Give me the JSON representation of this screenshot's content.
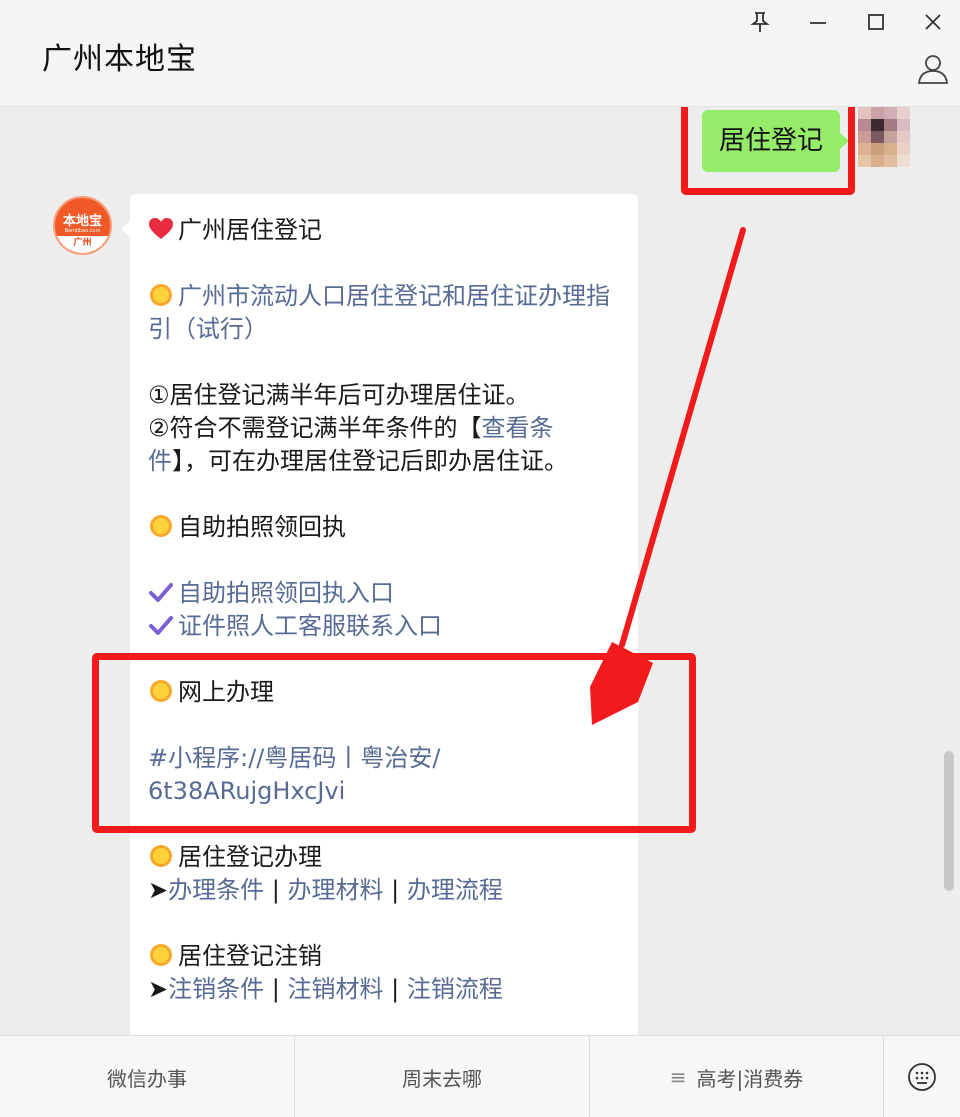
{
  "window": {
    "title": "广州本地宝",
    "controls": [
      "pin-icon",
      "minimize-icon",
      "maximize-icon",
      "close-icon",
      "profile-icon"
    ]
  },
  "sent_message": {
    "text": "居住登记"
  },
  "bot": {
    "avatar": {
      "logo_text": "本地宝",
      "domain_text": "Bendibao.com",
      "city": "广州"
    }
  },
  "reply": {
    "heading": "广州居住登记",
    "guide_link_line1": "广州市流动人口居住登记和居住证办理指",
    "guide_link_line2": "引（试行）",
    "note1": "①居住登记满半年后可办理居住证。",
    "note2_prefix": "②符合不需登记满半年条件的【",
    "note2_link_a": "查看条",
    "note2_link_b": "件",
    "note2_suffix": "】，可在办理居住登记后即办居住证。",
    "self_photo_title": "自助拍照领回执",
    "self_photo_link": "自助拍照领回执入口",
    "service_link": "证件照人工客服联系入口",
    "online_title": "网上办理",
    "miniprogram_line1": "#小程序://粤居码丨粤治安/",
    "miniprogram_line2": "6t38ARujgHxcJvi",
    "register_title": "居住登记办理",
    "register_links": [
      "办理条件",
      "办理材料",
      "办理流程"
    ],
    "cancel_title": "居住登记注销",
    "cancel_links": [
      "注销条件",
      "注销材料",
      "注销流程"
    ],
    "arrow_glyph": "➤",
    "separator": "|"
  },
  "menu": {
    "items": [
      {
        "label": "微信办事"
      },
      {
        "label": "周末去哪"
      },
      {
        "label": "高考|消费券",
        "prefix": "≡"
      }
    ],
    "keyboard_icon": "keyboard-icon"
  },
  "colors": {
    "sent_bubble": "#95ec69",
    "link": "#576b95",
    "highlight": "#f21a1a",
    "avatar_brand": "#f05a28"
  }
}
